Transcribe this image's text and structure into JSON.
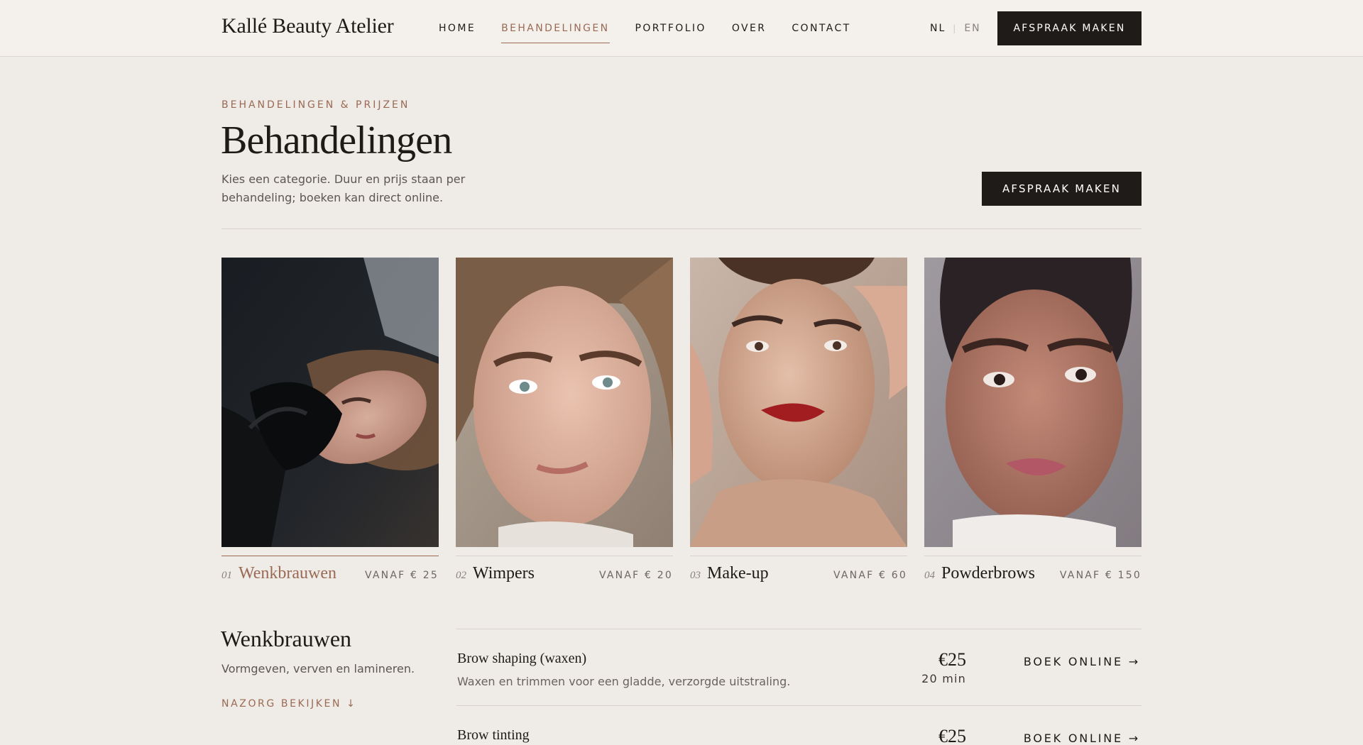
{
  "header": {
    "logo": "Kallé Beauty Atelier",
    "nav": [
      {
        "label": "HOME",
        "active": false
      },
      {
        "label": "BEHANDELINGEN",
        "active": true
      },
      {
        "label": "PORTFOLIO",
        "active": false
      },
      {
        "label": "OVER",
        "active": false
      },
      {
        "label": "CONTACT",
        "active": false
      }
    ],
    "lang": {
      "nl": "NL",
      "en": "EN",
      "active": "NL"
    },
    "cta": "AFSPRAAK MAKEN"
  },
  "intro": {
    "eyebrow": "BEHANDELINGEN & PRIJZEN",
    "title": "Behandelingen",
    "text": "Kies een categorie. Duur en prijs staan per behandeling; boeken kan direct online.",
    "cta": "AFSPRAAK MAKEN"
  },
  "categories": [
    {
      "num": "01",
      "name": "Wenkbrauwen",
      "price": "VANAF € 25",
      "active": true
    },
    {
      "num": "02",
      "name": "Wimpers",
      "price": "VANAF € 20",
      "active": false
    },
    {
      "num": "03",
      "name": "Make-up",
      "price": "VANAF € 60",
      "active": false
    },
    {
      "num": "04",
      "name": "Powderbrows",
      "price": "VANAF € 150",
      "active": false
    }
  ],
  "detail": {
    "title": "Wenkbrauwen",
    "subtitle": "Vormgeven, verven en lamineren.",
    "aftercare": "NAZORG BEKIJKEN ↓",
    "treatments": [
      {
        "name": "Brow shaping (waxen)",
        "desc": "Waxen en trimmen voor een gladde, verzorgde uitstraling.",
        "price": "€25",
        "duration": "20 min",
        "book": "BOEK ONLINE →"
      },
      {
        "name": "Brow tinting",
        "desc": "",
        "price": "€25",
        "duration": "",
        "book": "BOEK ONLINE →"
      }
    ]
  },
  "colors": {
    "accent": "#9a6a55",
    "dark": "#1f1b19",
    "background": "#efebe6",
    "header": "#f4f1ed"
  }
}
